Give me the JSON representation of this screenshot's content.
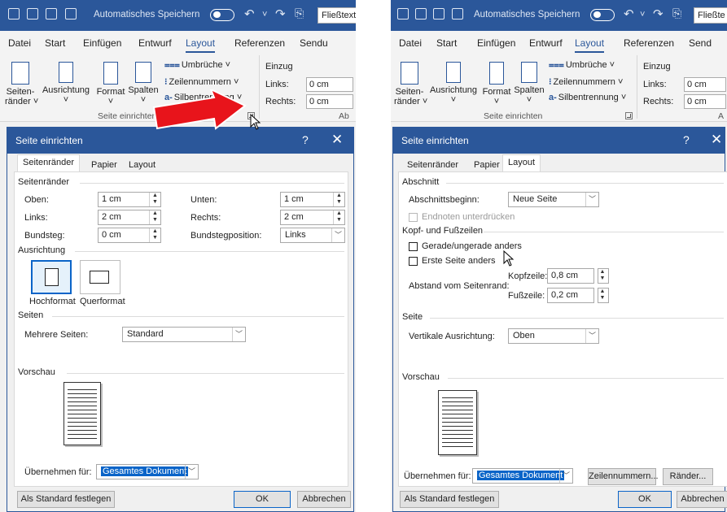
{
  "left": {
    "autosave_label": "Automatisches Speichern",
    "style_box": "Fließtext",
    "tabs": [
      "Datei",
      "Start",
      "Einfügen",
      "Entwurf",
      "Layout",
      "Referenzen",
      "Sendu"
    ],
    "ribbon": {
      "seitenraender": "Seiten-\nränder ˅",
      "ausrichtung": "Ausrichtung\n˅",
      "format": "Format\n˅",
      "spalten": "Spalten\n˅",
      "umbrueche": "Umbrüche ˅",
      "zeilennummern": "Zeilennummern ˅",
      "silbentrennung": "Silbentrennung ˅",
      "einzug_title": "Einzug",
      "links_label": "Links:",
      "links_value": "0 cm",
      "rechts_label": "Rechts:",
      "rechts_value": "0 cm",
      "group_label": "Seite einrichten",
      "next_group": "Ab"
    },
    "dialog": {
      "title": "Seite einrichten",
      "help": "?",
      "close": "✕",
      "tabs": [
        "Seitenränder",
        "Papier",
        "Layout"
      ],
      "sec_margins": "Seitenränder",
      "oben_label": "Oben:",
      "oben_value": "1 cm",
      "unten_label": "Unten:",
      "unten_value": "1 cm",
      "links_label": "Links:",
      "links_value": "2 cm",
      "rechts_label": "Rechts:",
      "rechts_value": "2 cm",
      "bundsteg_label": "Bundsteg:",
      "bundsteg_value": "0 cm",
      "bundstegpos_label": "Bundstegposition:",
      "bundstegpos_value": "Links",
      "sec_orientation": "Ausrichtung",
      "hochformat": "Hochformat",
      "querformat": "Querformat",
      "sec_pages": "Seiten",
      "mehrere_label": "Mehrere Seiten:",
      "mehrere_value": "Standard",
      "sec_preview": "Vorschau",
      "apply_label": "Übernehmen für:",
      "apply_value": "Gesamtes Dokument",
      "default_btn": "Als Standard festlegen",
      "ok": "OK",
      "cancel": "Abbrechen"
    }
  },
  "right": {
    "autosave_label": "Automatisches Speichern",
    "style_box": "Fließte",
    "tabs": [
      "Datei",
      "Start",
      "Einfügen",
      "Entwurf",
      "Layout",
      "Referenzen",
      "Send"
    ],
    "ribbon": {
      "seitenraender": "Seiten-\nränder ˅",
      "ausrichtung": "Ausrichtung\n˅",
      "format": "Format\n˅",
      "spalten": "Spalten\n˅",
      "umbrueche": "Umbrüche ˅",
      "zeilennummern": "Zeilennummern ˅",
      "silbentrennung": "Silbentrennung ˅",
      "einzug_title": "Einzug",
      "links_label": "Links:",
      "links_value": "0 cm",
      "rechts_label": "Rechts:",
      "rechts_value": "0 cm",
      "group_label": "Seite einrichten",
      "next_group": "A"
    },
    "dialog": {
      "title": "Seite einrichten",
      "help": "?",
      "close": "✕",
      "tabs": [
        "Seitenränder",
        "Papier",
        "Layout"
      ],
      "sec_section": "Abschnitt",
      "abschnittsbeginn_label": "Abschnittsbeginn:",
      "abschnittsbeginn_value": "Neue Seite",
      "endnoten": "Endnoten unterdrücken",
      "sec_headers": "Kopf- und Fußzeilen",
      "gerade": "Gerade/ungerade anders",
      "erste": "Erste Seite anders",
      "abstand_label": "Abstand vom Seitenrand:",
      "kopfzeile_label": "Kopfzeile:",
      "kopfzeile_value": "0,8 cm",
      "fusszeile_label": "Fußzeile:",
      "fusszeile_value": "0,2 cm",
      "sec_page": "Seite",
      "vertikal_label": "Vertikale Ausrichtung:",
      "vertikal_value": "Oben",
      "sec_preview": "Vorschau",
      "apply_label": "Übernehmen für:",
      "apply_value": "Gesamtes Dokument",
      "zeilennummern_btn": "Zeilennummern...",
      "raender_btn": "Ränder...",
      "default_btn": "Als Standard festlegen",
      "ok": "OK",
      "cancel": "Abbrechen"
    }
  },
  "colors": {
    "word_blue": "#2b579a",
    "selection_blue": "#0a64c8",
    "arrow_red": "#e8141b"
  }
}
